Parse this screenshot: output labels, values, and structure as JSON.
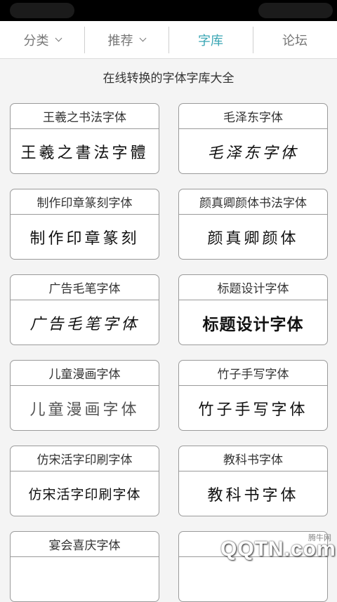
{
  "tabs": [
    {
      "label": "分类",
      "dropdown": true,
      "active": false
    },
    {
      "label": "推荐",
      "dropdown": true,
      "active": false
    },
    {
      "label": "字库",
      "dropdown": false,
      "active": true
    },
    {
      "label": "论坛",
      "dropdown": false,
      "active": false
    }
  ],
  "accent_color": "#3aa6b4",
  "heading": "在线转换的字体字库大全",
  "fonts": [
    {
      "title": "王羲之书法字体",
      "sample": "王羲之書法字體"
    },
    {
      "title": "毛泽东字体",
      "sample": "毛泽东字体"
    },
    {
      "title": "制作印章篆刻字体",
      "sample": "制作印章篆刻"
    },
    {
      "title": "颜真卿颜体书法字体",
      "sample": "颜真卿颜体"
    },
    {
      "title": "广告毛笔字体",
      "sample": "广告毛笔字体"
    },
    {
      "title": "标题设计字体",
      "sample": "标题设计字体"
    },
    {
      "title": "儿童漫画字体",
      "sample": "儿童漫画字体"
    },
    {
      "title": "竹子手写字体",
      "sample": "竹子手写字体"
    },
    {
      "title": "仿宋活字印刷字体",
      "sample": "仿宋活字印刷字体"
    },
    {
      "title": "教科书字体",
      "sample": "教科书字体"
    },
    {
      "title": "宴会喜庆字体",
      "sample": ""
    },
    {
      "title": "",
      "sample": ""
    }
  ],
  "watermark": {
    "site": "腾牛网",
    "logo": "QQTN.com"
  }
}
